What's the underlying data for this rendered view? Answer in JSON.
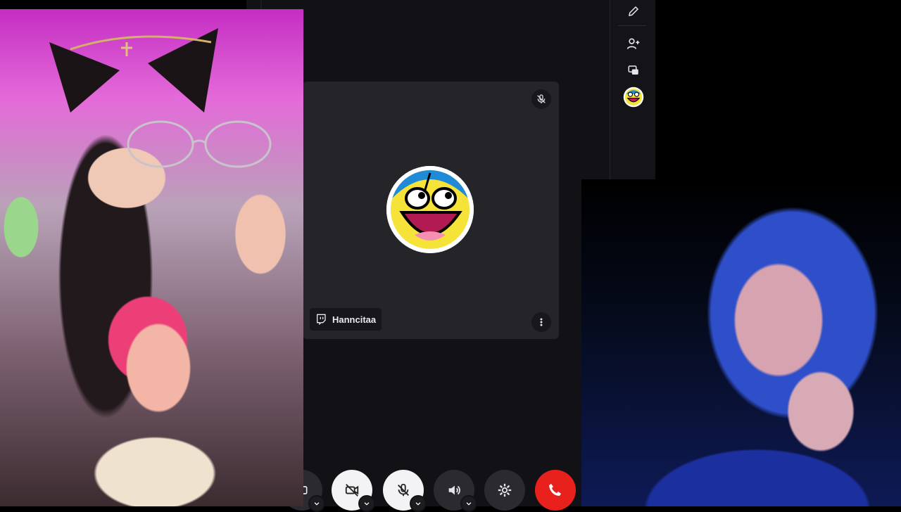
{
  "call": {
    "participant_name": "Hanncitaa",
    "tile_bg": "#242429",
    "accent_red": "#e8211c"
  },
  "icons": {
    "rail": [
      "pencil-icon",
      "add-user-icon",
      "screen-share-icon",
      "user-avatar-icon"
    ],
    "tile": [
      "muted-mic-icon",
      "twitch-icon",
      "more-vertical-icon"
    ],
    "controls": [
      "camera-off-icon",
      "mic-off-icon",
      "speaker-icon",
      "gear-icon",
      "hang-up-icon",
      "chevron-down-icon"
    ]
  }
}
